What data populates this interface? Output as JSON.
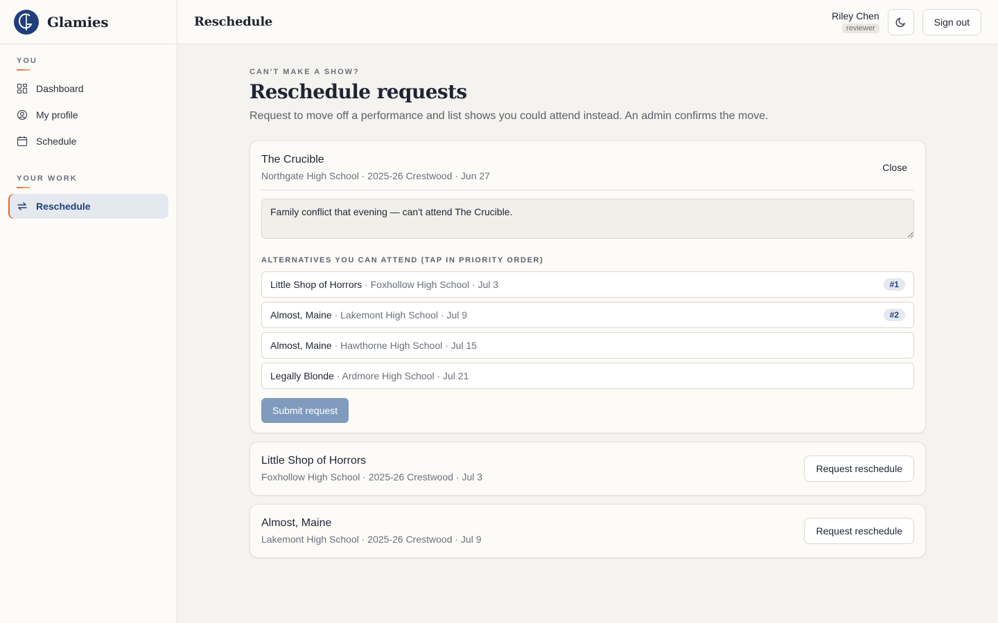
{
  "brand": {
    "name": "Glamies",
    "logo_icon": "g-logo-icon"
  },
  "sidebar": {
    "sections": [
      {
        "heading": "YOU",
        "items": [
          {
            "label": "Dashboard",
            "icon": "grid-icon"
          },
          {
            "label": "My profile",
            "icon": "user-circle-icon"
          },
          {
            "label": "Schedule",
            "icon": "calendar-icon"
          }
        ]
      },
      {
        "heading": "YOUR WORK",
        "items": [
          {
            "label": "Reschedule",
            "icon": "swap-icon",
            "active": true
          }
        ]
      }
    ]
  },
  "header": {
    "title": "Reschedule",
    "user_name": "Riley Chen",
    "user_role": "reviewer",
    "theme_toggle_icon": "moon-icon",
    "sign_out_label": "Sign out"
  },
  "main": {
    "eyebrow": "CAN'T MAKE A SHOW?",
    "title": "Reschedule requests",
    "lede": "Request to move off a performance and list shows you could attend instead. An admin confirms the move.",
    "open_request": {
      "show_title": "The Crucible",
      "show_meta": "Northgate High School · 2025-26 Crestwood · Jun 27",
      "close_label": "Close",
      "reason": "Family conflict that evening — can't attend The Crucible.",
      "alternatives_heading": "ALTERNATIVES YOU CAN ATTEND (TAP IN PRIORITY ORDER)",
      "alternatives": [
        {
          "title": "Little Shop of Horrors",
          "rest": " · Foxhollow High School · Jul 3",
          "rank": "#1"
        },
        {
          "title": "Almost, Maine",
          "rest": " · Lakemont High School · Jul 9",
          "rank": "#2"
        },
        {
          "title": "Almost, Maine",
          "rest": " · Hawthorne High School · Jul 15",
          "rank": null
        },
        {
          "title": "Legally Blonde",
          "rest": " · Ardmore High School · Jul 21",
          "rank": null
        }
      ],
      "submit_label": "Submit request"
    },
    "other_shows": [
      {
        "title": "Little Shop of Horrors",
        "meta": "Foxhollow High School · 2025-26 Crestwood · Jul 3",
        "action": "Request reschedule"
      },
      {
        "title": "Almost, Maine",
        "meta": "Lakemont High School · 2025-26 Crestwood · Jul 9",
        "action": "Request reschedule"
      }
    ]
  },
  "colors": {
    "brand": "#1f3f7a",
    "accent": "#e0662a",
    "background": "#f5f3ef",
    "submit_disabled": "#7f9bbd"
  }
}
